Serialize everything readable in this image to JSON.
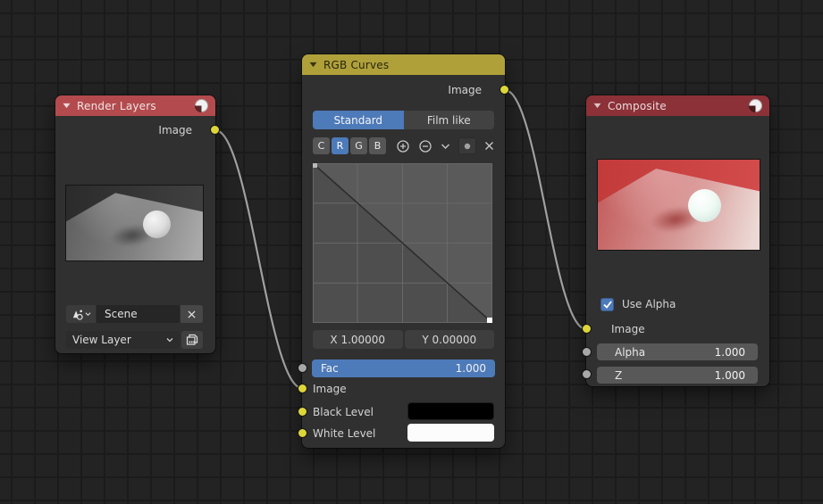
{
  "editor": {
    "background_color": "#232323",
    "grid_line_color": "#1b1b1b",
    "wire_color": "#a0a0a0"
  },
  "socket_colors": {
    "image": "#dcd63b",
    "value": "#a8a8a8"
  },
  "links": [
    {
      "from": "Render Layers.Image",
      "to": "RGB Curves.Image"
    },
    {
      "from": "RGB Curves.Image",
      "to": "Composite.Image"
    }
  ],
  "nodes": {
    "render_layers": {
      "title": "Render Layers",
      "header_color": "#b34b4e",
      "output_image_label": "Image",
      "scene_value": "Scene",
      "view_layer_value": "View Layer"
    },
    "rgb_curves": {
      "title": "RGB Curves",
      "header_color": "#afa03a",
      "output_image_label": "Image",
      "tone_tab_standard": "Standard",
      "tone_tab_film_like": "Film like",
      "active_tab": "Standard",
      "channel_c": "C",
      "channel_r": "R",
      "channel_g": "G",
      "channel_b": "B",
      "active_channel": "R",
      "selected_point_x": "X 1.00000",
      "selected_point_y": "Y 0.00000",
      "fac_label": "Fac",
      "fac_value": "1.000",
      "image_input_label": "Image",
      "black_level_label": "Black Level",
      "black_level_color": "#000000",
      "white_level_label": "White Level",
      "white_level_color": "#ffffff",
      "curve": {
        "points": [
          {
            "x": 0.0,
            "y": 1.0
          },
          {
            "x": 1.0,
            "y": 0.0
          }
        ],
        "selected_point": {
          "x": 1.0,
          "y": 0.0
        }
      }
    },
    "composite": {
      "title": "Composite",
      "header_color": "#8c3137",
      "use_alpha_label": "Use Alpha",
      "use_alpha_checked": true,
      "image_input_label": "Image",
      "alpha_label": "Alpha",
      "alpha_value": "1.000",
      "z_label": "Z",
      "z_value": "1.000"
    }
  }
}
